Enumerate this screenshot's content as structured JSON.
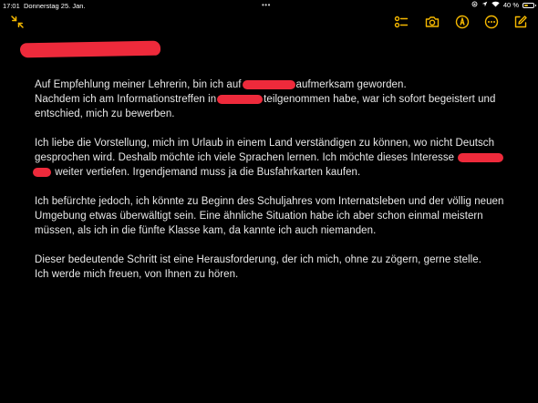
{
  "status_bar": {
    "time": "17:01",
    "date": "Donnerstag 25. Jan.",
    "multitask_dots": "•••",
    "battery_percent": "40 %",
    "battery_level": 0.4
  },
  "toolbar": {
    "accent_color": "#f5b800",
    "icons": [
      "collapse-icon",
      "checklist-icon",
      "camera-icon",
      "markup-pen-icon",
      "more-icon",
      "compose-icon"
    ]
  },
  "note": {
    "redaction_color": "#ee2a3b",
    "p1": {
      "l1a": "Auf Empfehlung meiner Lehrerin, bin ich auf",
      "l1b": "aufmerksam geworden.",
      "l2a": "Nachdem ich am Informationstreffen in",
      "l2b": "teilgenommen habe, war ich sofort begeistert und",
      "l3": "entschied, mich zu bewerben."
    },
    "p2": {
      "l1": "Ich liebe die Vorstellung, mich im Urlaub in einem Land verständigen zu können, wo nicht Deutsch",
      "l2a": "gesprochen wird. Deshalb möchte ich viele Sprachen lernen. Ich möchte dieses Interesse",
      "l3b": "weiter vertiefen. Irgendjemand muss ja die Busfahrkarten kaufen."
    },
    "p3": {
      "l1": "Ich befürchte jedoch, ich könnte zu Beginn des Schuljahres vom Internatsleben und der völlig neuen",
      "l2": "Umgebung etwas überwältigt sein. Eine ähnliche Situation habe ich aber schon einmal meistern",
      "l3": "müssen, als ich in die fünfte Klasse kam, da kannte ich auch niemanden."
    },
    "p4": {
      "l1": "Dieser bedeutende Schritt ist eine Herausforderung, der ich mich, ohne zu zögern, gerne stelle.",
      "l2": "Ich werde mich freuen, von Ihnen zu hören."
    }
  }
}
